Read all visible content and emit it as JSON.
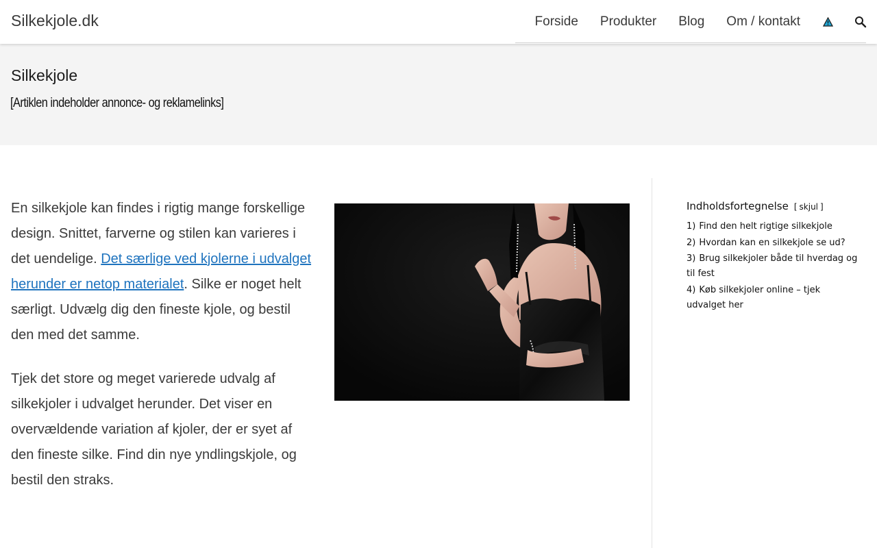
{
  "header": {
    "site_title": "Silkekjole.dk",
    "nav": [
      "Forside",
      "Produkter",
      "Blog",
      "Om / kontakt"
    ],
    "icons": [
      "warning-icon",
      "search-icon"
    ],
    "accent_color": "#1e73be"
  },
  "title_band": {
    "title": "Silkekjole",
    "disclaimer": "[Artiklen indeholder annonce- og reklamelinks]"
  },
  "content": {
    "p1_before": "En silkekjole kan findes i rigtig mange forskellige design. Snittet, farverne og stilen kan varieres i det uendelige. ",
    "p1_link": "Det særlige ved kjolerne i udvalget herunder er netop materialet",
    "p1_after": ". Silke er noget helt særligt. Udvælg dig den fineste kjole, og bestil den med det samme.",
    "p2": "Tjek det store og meget varierede udvalg af silkekjoler i udvalget herunder. Det viser en overvældende variation af kjoler, der er syet af den fineste silke. Find din nye yndlingskjole, og bestil den straks."
  },
  "toc": {
    "title": "Indholdsfortegnelse",
    "toggle_open": "[",
    "toggle_label": "skjul",
    "toggle_close": "]",
    "items": [
      {
        "num": "1)",
        "label": "Find den helt rigtige silkekjole"
      },
      {
        "num": "2)",
        "label": "Hvordan kan en silkekjole se ud?"
      },
      {
        "num": "3)",
        "label": "Brug silkekjoler både til hverdag og til fest"
      },
      {
        "num": "4)",
        "label": "Køb silkekjoler online – tjek udvalget her"
      }
    ]
  }
}
